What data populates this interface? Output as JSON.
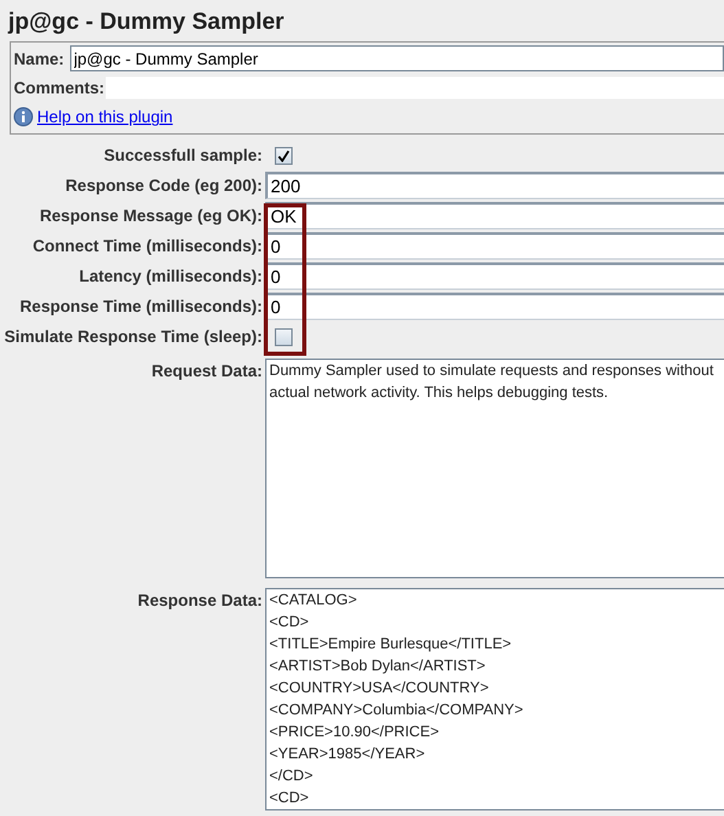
{
  "title": "jp@gc - Dummy Sampler",
  "name_field": {
    "label": "Name:",
    "value": "jp@gc - Dummy Sampler"
  },
  "comments_field": {
    "label": "Comments:"
  },
  "help_link": "Help on this plugin",
  "fields": [
    {
      "kind": "checkbox",
      "label": "Successfull sample:",
      "checked": true
    },
    {
      "kind": "text",
      "label": "Response Code (eg 200):",
      "value": "200"
    },
    {
      "kind": "text",
      "label": "Response Message (eg OK):",
      "value": "OK"
    },
    {
      "kind": "text",
      "label": "Connect Time (milliseconds):",
      "value": "0"
    },
    {
      "kind": "text",
      "label": "Latency (milliseconds):",
      "value": "0"
    },
    {
      "kind": "text",
      "label": "Response Time (milliseconds):",
      "value": "0"
    },
    {
      "kind": "checkbox",
      "label": "Simulate Response Time (sleep):",
      "checked": false
    }
  ],
  "request_data": {
    "label": "Request Data:",
    "text": "Dummy Sampler used to simulate requests and responses without actual network activity. This helps debugging tests."
  },
  "response_data": {
    "label": "Response Data:",
    "lines": [
      "<CATALOG>",
      "<CD>",
      "<TITLE>Empire Burlesque</TITLE>",
      "<ARTIST>Bob Dylan</ARTIST>",
      "<COUNTRY>USA</COUNTRY>",
      "<COMPANY>Columbia</COMPANY>",
      "<PRICE>10.90</PRICE>",
      "<YEAR>1985</YEAR>",
      "</CD>",
      "<CD>"
    ]
  }
}
